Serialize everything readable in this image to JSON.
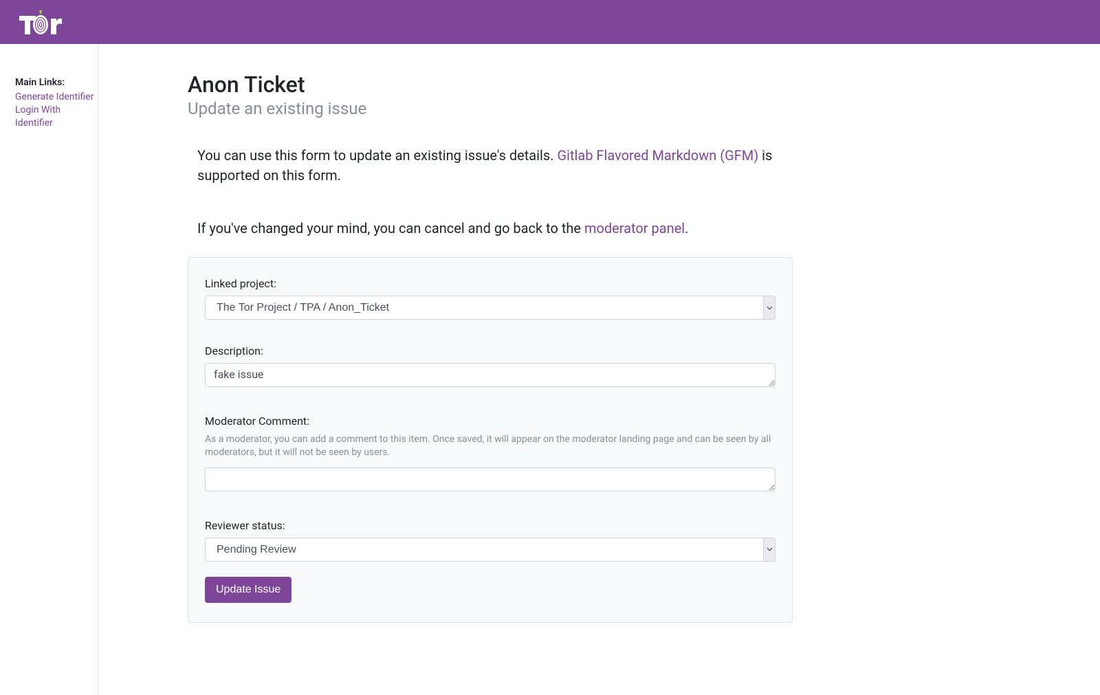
{
  "sidebar": {
    "heading": "Main Links:",
    "links": [
      {
        "label": "Generate Identifier"
      },
      {
        "label": "Login With Identifier"
      }
    ]
  },
  "page": {
    "title": "Anon Ticket",
    "subtitle": "Update an existing issue",
    "intro_before": "You can use this form to update an existing issue's details. ",
    "intro_link": "Gitlab Flavored Markdown (GFM)",
    "intro_after": " is supported on this form.",
    "cancel_before": "If you've changed your mind, you can cancel and go back to the ",
    "cancel_link": "moderator panel",
    "cancel_after": "."
  },
  "form": {
    "linked_project": {
      "label": "Linked project:",
      "value": "The Tor Project / TPA / Anon_Ticket"
    },
    "description": {
      "label": "Description:",
      "value": "fake issue"
    },
    "moderator_comment": {
      "label": "Moderator Comment:",
      "help": "As a moderator, you can add a comment to this item. Once saved, it will appear on the moderator landing page and can be seen by all moderators, but it will not be seen by users.",
      "value": ""
    },
    "reviewer_status": {
      "label": "Reviewer status:",
      "value": "Pending Review"
    },
    "submit_label": "Update Issue"
  }
}
